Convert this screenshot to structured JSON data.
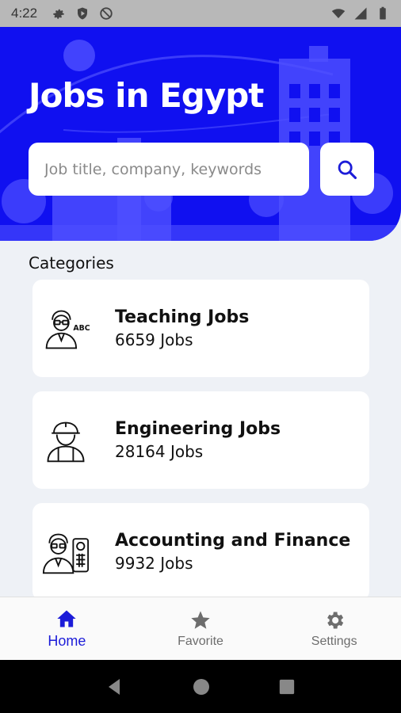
{
  "status_bar": {
    "time": "4:22"
  },
  "hero": {
    "title": "Jobs in Egypt",
    "search_placeholder": "Job title, company, keywords",
    "accent_color": "#1010f0"
  },
  "categories": {
    "heading": "Categories",
    "items": [
      {
        "title": "Teaching Jobs",
        "count": "6659  Jobs",
        "icon": "teacher-icon"
      },
      {
        "title": "Engineering Jobs",
        "count": "28164  Jobs",
        "icon": "engineer-icon"
      },
      {
        "title": "Accounting and Finance",
        "count": "9932  Jobs",
        "icon": "accountant-icon"
      }
    ]
  },
  "bottom_nav": {
    "items": [
      {
        "label": "Home",
        "icon": "home-icon",
        "active": true
      },
      {
        "label": "Favorite",
        "icon": "star-icon",
        "active": false
      },
      {
        "label": "Settings",
        "icon": "gear-icon",
        "active": false
      }
    ]
  }
}
